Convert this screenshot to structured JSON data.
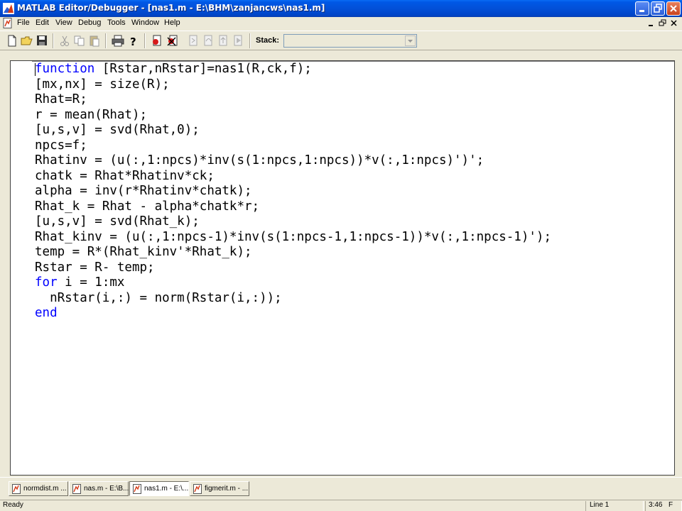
{
  "window": {
    "title": "MATLAB Editor/Debugger - [nas1.m - E:\\BHM\\zanjancws\\nas1.m]"
  },
  "menu": {
    "items": [
      "File",
      "Edit",
      "View",
      "Debug",
      "Tools",
      "Window",
      "Help"
    ]
  },
  "toolbar": {
    "stack_label": "Stack:",
    "stack_value": ""
  },
  "editor": {
    "lines": [
      {
        "kw": "function",
        "rest": " [Rstar,nRstar]=nas1(R,ck,f);"
      },
      {
        "kw": "",
        "rest": "[mx,nx] = size(R);"
      },
      {
        "kw": "",
        "rest": "Rhat=R;"
      },
      {
        "kw": "",
        "rest": "r = mean(Rhat);"
      },
      {
        "kw": "",
        "rest": "[u,s,v] = svd(Rhat,0);"
      },
      {
        "kw": "",
        "rest": "npcs=f;"
      },
      {
        "kw": "",
        "rest": "Rhatinv = (u(:,1:npcs)*inv(s(1:npcs,1:npcs))*v(:,1:npcs)')';"
      },
      {
        "kw": "",
        "rest": "chatk = Rhat*Rhatinv*ck;"
      },
      {
        "kw": "",
        "rest": "alpha = inv(r*Rhatinv*chatk);"
      },
      {
        "kw": "",
        "rest": "Rhat_k = Rhat - alpha*chatk*r;"
      },
      {
        "kw": "",
        "rest": "[u,s,v] = svd(Rhat_k);"
      },
      {
        "kw": "",
        "rest": "Rhat_kinv = (u(:,1:npcs-1)*inv(s(1:npcs-1,1:npcs-1))*v(:,1:npcs-1)');"
      },
      {
        "kw": "",
        "rest": "temp = R*(Rhat_kinv'*Rhat_k);"
      },
      {
        "kw": "",
        "rest": "Rstar = R- temp;"
      },
      {
        "kw": "for",
        "rest": " i = 1:mx"
      },
      {
        "kw": "",
        "rest": "  nRstar(i,:) = norm(Rstar(i,:));"
      },
      {
        "kw": "end",
        "rest": ""
      }
    ]
  },
  "tabs": [
    {
      "label": "normdist.m ..."
    },
    {
      "label": "nas.m - E:\\B..."
    },
    {
      "label": "nas1.m - E:\\..."
    },
    {
      "label": "figmerit.m - ..."
    }
  ],
  "status": {
    "ready": "Ready",
    "line": "Line 1",
    "time": "3:46"
  },
  "colors": {
    "keyword": "#0000ff",
    "titlebar": "#0250d8"
  }
}
